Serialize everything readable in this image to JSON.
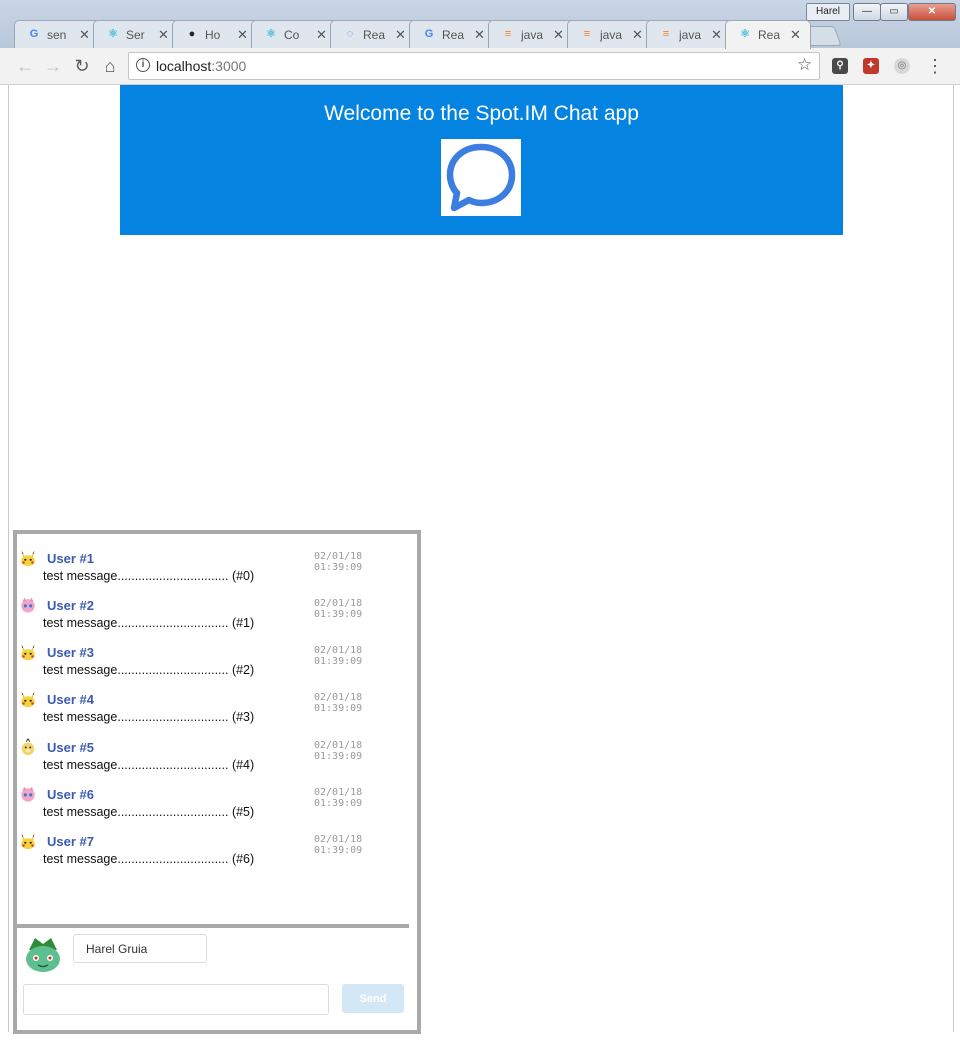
{
  "window": {
    "profile_name": "Harel",
    "minimize": "—",
    "maximize": "▭",
    "close": "✕"
  },
  "tabs": [
    {
      "label": "sen",
      "icon": "google-icon",
      "color": "#4285f4",
      "glyph": "G"
    },
    {
      "label": "Ser",
      "icon": "react-icon",
      "color": "#53c1de",
      "glyph": "⚛"
    },
    {
      "label": "Ho",
      "icon": "github-icon",
      "color": "#222222",
      "glyph": "●"
    },
    {
      "label": "Co",
      "icon": "react-icon",
      "color": "#53c1de",
      "glyph": "⚛"
    },
    {
      "label": "Rea",
      "icon": "loading-icon",
      "color": "#3b7de0",
      "glyph": "◌"
    },
    {
      "label": "Rea",
      "icon": "google-icon",
      "color": "#4285f4",
      "glyph": "G"
    },
    {
      "label": "java",
      "icon": "stackoverflow-icon",
      "color": "#f48024",
      "glyph": "≡"
    },
    {
      "label": "java",
      "icon": "stackoverflow-icon",
      "color": "#f48024",
      "glyph": "≡"
    },
    {
      "label": "java",
      "icon": "stackoverflow-icon",
      "color": "#f48024",
      "glyph": "≡"
    },
    {
      "label": "Rea",
      "icon": "react-icon",
      "color": "#53c1de",
      "glyph": "⚛",
      "active": true
    }
  ],
  "tab_close": "✕",
  "toolbar": {
    "back": "←",
    "forward": "→",
    "reload": "↻",
    "home": "⌂",
    "url_host": "localhost",
    "url_port": ":3000",
    "star": "☆",
    "menu": "⋮",
    "info": "i"
  },
  "header": {
    "title": "Welcome to the Spot.IM Chat app"
  },
  "messages": [
    {
      "user": "User #1",
      "time": "02/01/18 01:39:09",
      "text": "test message................................ (#0)",
      "avatar": "pikachu-icon"
    },
    {
      "user": "User #2",
      "time": "02/01/18 01:39:09",
      "text": "test message................................ (#1)",
      "avatar": "jigglypuff-icon"
    },
    {
      "user": "User #3",
      "time": "02/01/18 01:39:09",
      "text": "test message................................ (#2)",
      "avatar": "pikachu-icon"
    },
    {
      "user": "User #4",
      "time": "02/01/18 01:39:09",
      "text": "test message................................ (#3)",
      "avatar": "pikachu-icon"
    },
    {
      "user": "User #5",
      "time": "02/01/18 01:39:09",
      "text": "test message................................ (#4)",
      "avatar": "psyduck-icon"
    },
    {
      "user": "User #6",
      "time": "02/01/18 01:39:09",
      "text": "test message................................ (#5)",
      "avatar": "jigglypuff-icon"
    },
    {
      "user": "User #7",
      "time": "02/01/18 01:39:09",
      "text": "test message................................ (#6)",
      "avatar": "pikachu-icon"
    }
  ],
  "composer": {
    "username": "Harel Gruia",
    "message_value": "",
    "send_label": "Send"
  },
  "colors": {
    "header_bg": "#0483e0",
    "username": "#3a5bb0",
    "send_button": "#d4e7f7"
  }
}
